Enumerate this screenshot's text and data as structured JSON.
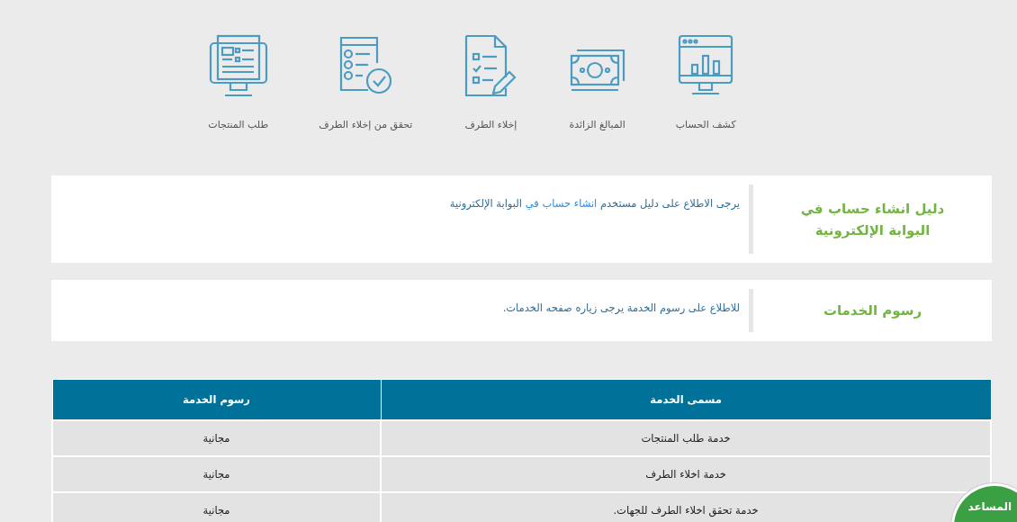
{
  "services": [
    {
      "label": "كشف الحساب"
    },
    {
      "label": "المبالغ الزائدة"
    },
    {
      "label": "إخلاء الطرف"
    },
    {
      "label": "تحقق من إخلاء الطرف"
    },
    {
      "label": "طلب المنتجات"
    }
  ],
  "info_cards": [
    {
      "title": "دليل انشاء حساب في البوابة الإلكترونية",
      "text_before": "يرجى الاطلاع على دليل مستخدم ",
      "link": "انشاء حساب في",
      "text_after": " البوابة الإلكترونية"
    },
    {
      "title": "رسوم الخدمات",
      "text_before": "للاطلاع على رسوم الخدمة يرجى زياره صفحه الخدمات."
    }
  ],
  "fees_table": {
    "columns": [
      "مسمى الخدمة",
      "رسوم الخدمة"
    ],
    "rows": [
      [
        "خدمة طلب المنتجات",
        "مجانية"
      ],
      [
        "خدمة اخلاء الطرف",
        "مجانية"
      ],
      [
        "خدمة تحقق اخلاء الطرف للجهات.",
        "مجانية"
      ]
    ]
  },
  "helper_button": {
    "label": "المساعد"
  }
}
